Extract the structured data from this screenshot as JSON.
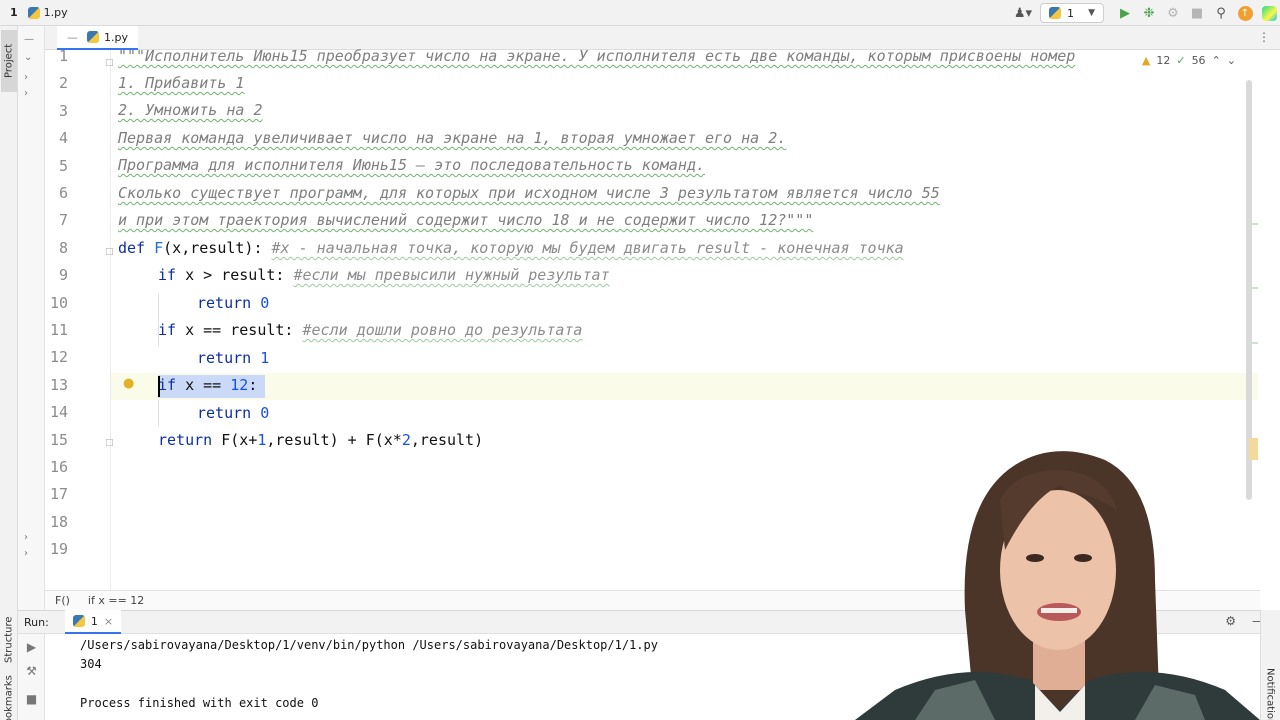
{
  "navbar": {
    "project_num": "1",
    "file_name": "1.py",
    "run_config": "1"
  },
  "left_strip": {
    "project": "Project",
    "structure": "Structure",
    "bookmarks": "Bookmarks"
  },
  "tab": {
    "label": "1.py"
  },
  "editor": {
    "inspections": {
      "warnings": "12",
      "typos": "56"
    },
    "line_numbers": [
      "1",
      "2",
      "3",
      "4",
      "5",
      "6",
      "7",
      "8",
      "9",
      "10",
      "11",
      "12",
      "13",
      "14",
      "15",
      "16",
      "17",
      "18",
      "19"
    ],
    "lines": {
      "l1": "\"\"\"Исполнитель Июнь15 преобразует число на экране. У исполнителя есть две команды, которым присвоены номер",
      "l2": "1. Прибавить 1",
      "l3": "2. Умножить на 2",
      "l4": "Первая команда увеличивает число на экране на 1, вторая умножает его на 2.",
      "l5": "Программа для исполнителя Июнь15 – это последовательность команд.",
      "l6": "Сколько существует программ, для которых при исходном числе 3 результатом является число 55",
      "l7": "и при этом траектория вычислений содержит число 18 и не содержит число 12?\"\"\"",
      "l8_kw": "def",
      "l8_fn": "F",
      "l8_sig": "(x,result):",
      "l8_cmt": "#x - начальная точка, которую мы будем двигать result - конечная точка",
      "l9_kw": "if",
      "l9_txt": "x > result:",
      "l9_cmt": "#если мы превысили нужный результат",
      "l10_kw": "return",
      "l10_num": "0",
      "l11_kw": "if",
      "l11_txt": "x == result:",
      "l11_cmt": "#если дошли ровно до результата",
      "l12_kw": "return",
      "l12_num": "1",
      "l13_kw": "if",
      "l13_txt": "x ==",
      "l13_num": "12",
      "l13_colon": ":",
      "l14_kw": "return",
      "l14_num": "0",
      "l15_kw": "return",
      "l15_a": "F(x+",
      "l15_n1": "1",
      "l15_b": ",result) + F(x*",
      "l15_n2": "2",
      "l15_c": ",result)"
    }
  },
  "breadcrumb": {
    "func": "F()",
    "stmt": "if x == 12"
  },
  "run": {
    "label": "Run:",
    "tab": "1",
    "console": {
      "command": "/Users/sabirovayana/Desktop/1/venv/bin/python /Users/sabirovayana/Desktop/1/1.py",
      "output": "304",
      "finish": "Process finished with exit code 0"
    }
  },
  "right_strip": {
    "notifications": "Notifications"
  },
  "colors": {
    "keyword": "#0c2ea6",
    "number": "#1750eb",
    "selection": "#c9d9f7",
    "accent": "#3574f0"
  }
}
